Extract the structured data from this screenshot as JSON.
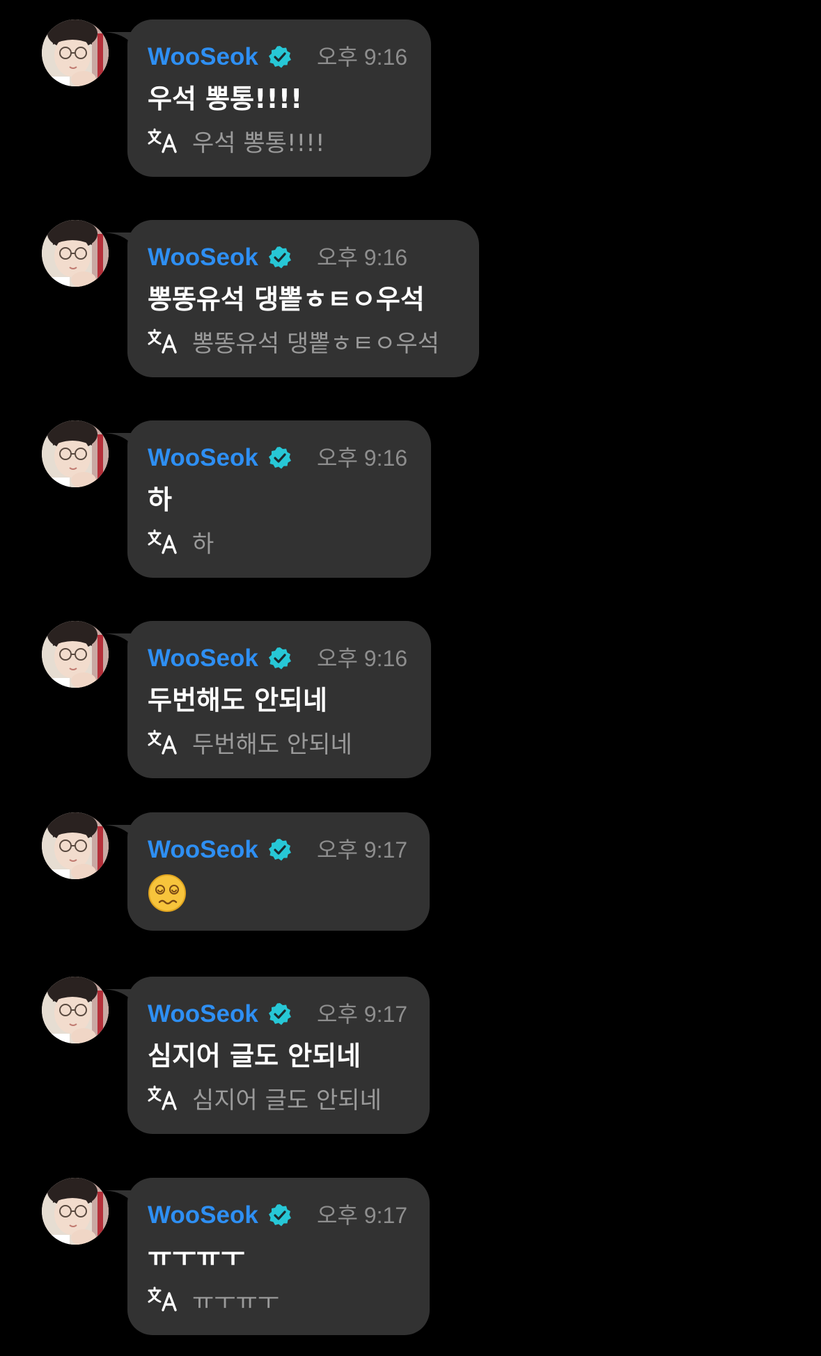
{
  "messages": [
    {
      "author": "WooSeok",
      "time": "오후 9:16",
      "text": "우석 뽕통!!!!",
      "translation": "우석 뽕통!!!!"
    },
    {
      "author": "WooSeok",
      "time": "오후 9:16",
      "text": "뽕똥유석 댕뽙ㅎㅌㅇ우석",
      "translation": "뽕똥유석 댕뽙ㅎㅌㅇ우석"
    },
    {
      "author": "WooSeok",
      "time": "오후 9:16",
      "text": "하",
      "translation": "하"
    },
    {
      "author": "WooSeok",
      "time": "오후 9:16",
      "text": "두번해도 안되네",
      "translation": "두번해도 안되네"
    },
    {
      "author": "WooSeok",
      "time": "오후 9:17",
      "emoji": "dizzy-face-emoji"
    },
    {
      "author": "WooSeok",
      "time": "오후 9:17",
      "text": "심지어 글도 안되네",
      "translation": "심지어 글도 안되네"
    },
    {
      "author": "WooSeok",
      "time": "오후 9:17",
      "text": "ㅠㅜㅠㅜ",
      "translation": "ㅠㅜㅠㅜ"
    }
  ],
  "colors": {
    "background": "#000000",
    "bubble": "#323232",
    "author": "#2e8ff3",
    "verified_badge": "#27c7d6",
    "timestamp": "#8e8e8e",
    "message_text": "#ffffff",
    "translation_text": "#9a9a9a"
  },
  "icons": {
    "verified": "verified-badge-icon",
    "translate": "translate-icon"
  }
}
